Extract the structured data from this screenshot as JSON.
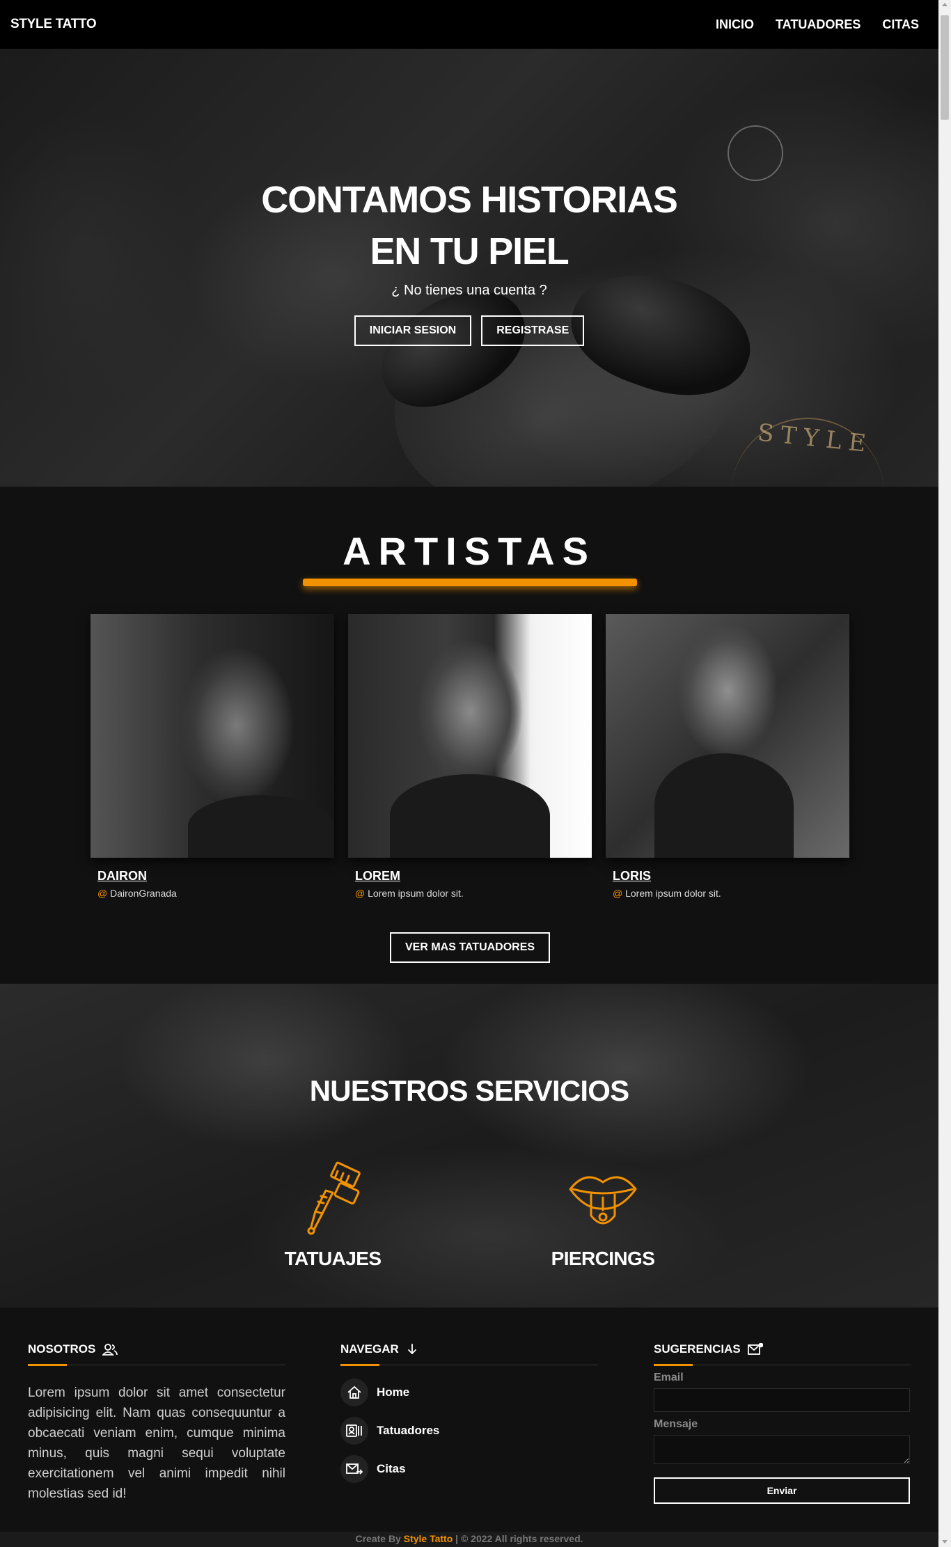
{
  "nav": {
    "brand": "STYLE TATTO",
    "links": [
      "INICIO",
      "TATUADORES",
      "CITAS"
    ]
  },
  "hero": {
    "title_line1": "CONTAMOS HISTORIAS",
    "title_line2": "EN TU PIEL",
    "subtitle": "¿ No tienes una cuenta ?",
    "login_button": "INICIAR SESION",
    "register_button": "REGISTRASE"
  },
  "artistas": {
    "title": "ARTISTAS",
    "cards": [
      {
        "name": "DAIRON",
        "handle": "DaironGranada"
      },
      {
        "name": "LOREM",
        "handle": "Lorem ipsum dolor sit."
      },
      {
        "name": "LORIS",
        "handle": "Lorem ipsum dolor sit."
      }
    ],
    "handle_prefix": "@",
    "more_button": "VER MAS TATUADORES"
  },
  "servicios": {
    "title": "NUESTROS SERVICIOS",
    "items": [
      {
        "label": "TATUAJES",
        "icon": "tattoo-machine-icon"
      },
      {
        "label": "PIERCINGS",
        "icon": "tongue-piercing-icon"
      }
    ]
  },
  "footer": {
    "nosotros": {
      "title": "NOSOTROS",
      "text": "Lorem ipsum dolor sit amet consectetur adipisicing elit. Nam quas consequuntur a obcaecati veniam enim, cumque minima minus, quis magni sequi voluptate exercitationem vel animi impedit nihil molestias sed id!"
    },
    "navegar": {
      "title": "NAVEGAR",
      "items": [
        "Home",
        "Tatuadores",
        "Citas"
      ]
    },
    "sugerencias": {
      "title": "SUGERENCIAS",
      "email_label": "Email",
      "message_label": "Mensaje",
      "send_button": "Enviar"
    },
    "credits_prefix": "Create By",
    "credits_brand": "Style Tatto",
    "credits_suffix": "| © 2022 All rights reserved."
  },
  "colors": {
    "accent": "#f39200",
    "background": "#111111",
    "nav": "#000000"
  }
}
